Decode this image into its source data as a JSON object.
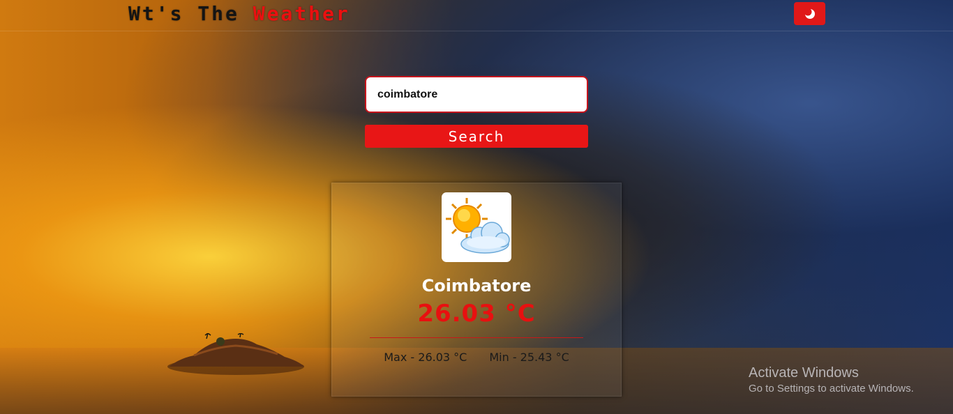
{
  "header": {
    "brand_prefix": "Wt's The ",
    "brand_accent": "Weather",
    "theme_toggle_icon": "moon-icon"
  },
  "search": {
    "value": "coimbatore",
    "placeholder": "",
    "button_label": "Search"
  },
  "weather": {
    "icon": "partly-cloudy-icon",
    "city": "Coimbatore",
    "temperature": "26.03 °C",
    "max": "Max - 26.03 °C",
    "min": "Min - 25.43 °C"
  },
  "watermark": {
    "title": "Activate Windows",
    "subtitle": "Go to Settings to activate Windows."
  },
  "colors": {
    "accent": "#e81616",
    "brand_dark": "#141414"
  }
}
